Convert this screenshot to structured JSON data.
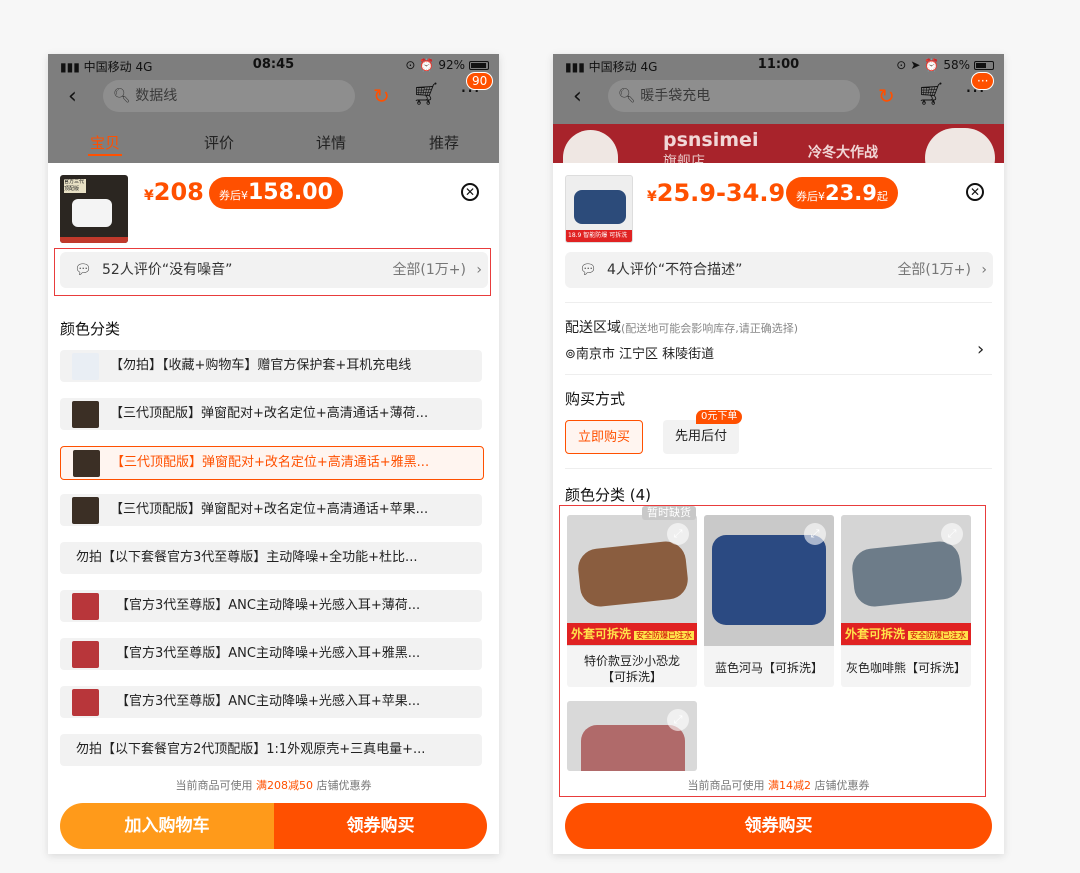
{
  "left": {
    "status": {
      "carrier": "中国移动 4G",
      "time": "08:45",
      "battery": "92%"
    },
    "search": {
      "placeholder": "数据线"
    },
    "cart_badge": "90",
    "tabs": [
      "宝贝",
      "评价",
      "详情",
      "推荐"
    ],
    "price": {
      "yen": "¥",
      "value": "208",
      "coupon_prefix": "券后",
      "coupon_yen": "¥",
      "coupon_value": "158.00"
    },
    "thumb_text": {
      "t1": "官方三代",
      "t2": "顶配版"
    },
    "review": {
      "text": "52人评价“没有噪音”",
      "all": "全部(1万+)"
    },
    "section_title": "颜色分类",
    "options": [
      "【勿拍】【收藏+购物车】赠官方保护套+耳机充电线",
      "【三代顶配版】弹窗配对+改名定位+高清通话+薄荷...",
      "【三代顶配版】弹窗配对+改名定位+高清通话+雅黑...",
      "【三代顶配版】弹窗配对+改名定位+高清通话+苹果...",
      "勿拍【以下套餐官方3代至尊版】主动降噪+全功能+杜比...",
      "【官方3代至尊版】ANC主动降噪+光感入耳+薄荷...",
      "【官方3代至尊版】ANC主动降噪+光感入耳+雅黑...",
      "【官方3代至尊版】ANC主动降噪+光感入耳+苹果...",
      "勿拍【以下套餐官方2代顶配版】1:1外观原壳+三真电量+..."
    ],
    "footnote": {
      "pre": "当前商品可使用",
      "hl": "满208减50",
      "post": "店铺优惠券"
    },
    "btn_cart": "加入购物车",
    "btn_buy": "领券购买"
  },
  "right": {
    "status": {
      "carrier": "中国移动 4G",
      "time": "11:00",
      "battery": "58%"
    },
    "search": {
      "placeholder": "暖手袋充电"
    },
    "cart_badge": "···",
    "banner": {
      "brand": "psnsimei",
      "sub": "旗舰店",
      "promo": "冷冬大作战"
    },
    "price": {
      "yen": "¥",
      "value": "25.9-34.9",
      "coupon_prefix": "券后",
      "coupon_yen": "¥",
      "coupon_value": "23.9",
      "coupon_suffix": "起"
    },
    "thumb_text": {
      "price": "18.9",
      "tag": "智能防爆 可拆洗"
    },
    "review": {
      "text": "4人评价“不符合描述”",
      "all": "全部(1万+)"
    },
    "delivery": {
      "title": "配送区域",
      "note": "(配送地可能会影响库存,请正确选择)",
      "address": "南京市 江宁区 秣陵街道"
    },
    "purchase": {
      "title": "购买方式",
      "opt1": "立即购买",
      "opt2": "先用后付",
      "opt2_badge": "0元下单"
    },
    "color_title": "颜色分类 (4)",
    "soldout": "暂时缺货",
    "strip": {
      "main": "外套可拆洗",
      "sub": "安全防爆已注水"
    },
    "items": [
      {
        "label": "特价款豆沙小恐龙\n【可拆洗】"
      },
      {
        "label": "蓝色河马【可拆洗】"
      },
      {
        "label": "灰色咖啡熊【可拆洗】"
      },
      {
        "label": ""
      }
    ],
    "footnote": {
      "pre": "当前商品可使用",
      "hl": "满14减2",
      "post": "店铺优惠券"
    },
    "btn_buy": "领券购买"
  },
  "colors": {
    "accent": "#ff5000",
    "accent_light": "#ff9a1a",
    "highlight_box": "#e83c3c"
  },
  "icons": [
    "signal-icon",
    "back-icon",
    "search-icon",
    "share-icon",
    "cart-icon",
    "more-icon",
    "close-icon",
    "comment-icon",
    "chevron-right-icon",
    "location-icon",
    "expand-icon"
  ]
}
